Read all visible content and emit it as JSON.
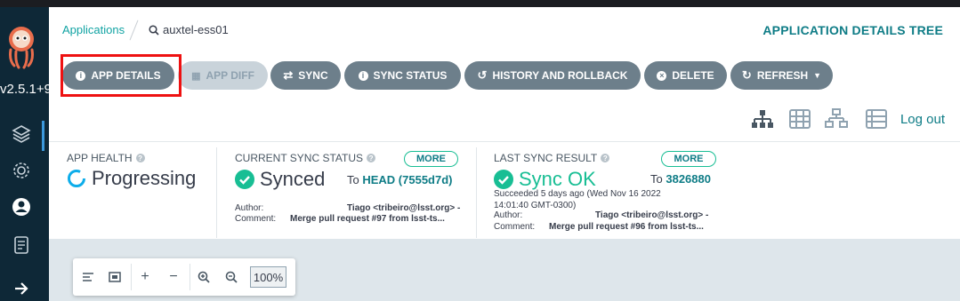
{
  "sidebar": {
    "version": "v2.5.1+9",
    "items": [
      "layers-icon",
      "gear-icon",
      "user-icon",
      "docs-icon",
      "arrow-right-icon"
    ]
  },
  "breadcrumb": {
    "applications": "Applications",
    "app_name": "auxtel-ess01"
  },
  "header": {
    "title": "APPLICATION DETAILS TREE"
  },
  "toolbar": {
    "app_details": "APP DETAILS",
    "app_diff": "APP DIFF",
    "sync": "SYNC",
    "sync_status": "SYNC STATUS",
    "history": "HISTORY AND ROLLBACK",
    "delete": "DELETE",
    "refresh": "REFRESH"
  },
  "view": {
    "logout": "Log out"
  },
  "app_health": {
    "label": "APP HEALTH",
    "value": "Progressing"
  },
  "current_sync": {
    "label": "CURRENT SYNC STATUS",
    "more": "MORE",
    "value": "Synced",
    "to_prefix": "To",
    "to_value": "HEAD (7555d7d)",
    "author_label": "Author:",
    "author_value": "Tiago <tribeiro@lsst.org> -",
    "comment_label": "Comment:",
    "comment_value": "Merge pull request #97 from lsst-ts..."
  },
  "last_sync": {
    "label": "LAST SYNC RESULT",
    "more": "MORE",
    "value": "Sync OK",
    "to_prefix": "To",
    "to_value": "3826880",
    "succeeded_line1": "Succeeded 5 days ago (Wed Nov 16 2022",
    "succeeded_line2": "14:01:40 GMT-0300)",
    "author_label": "Author:",
    "author_value": "Tiago <tribeiro@lsst.org> -",
    "comment_label": "Comment:",
    "comment_value": "Merge pull request #96 from lsst-ts..."
  },
  "graph_toolbar": {
    "zoom": "100%"
  },
  "colors": {
    "sidebar": "#0e2837",
    "button": "#6d7f8b",
    "accent": "#0e7c86",
    "success": "#18be94",
    "progress": "#0dadea",
    "highlight": "#ee1111"
  }
}
